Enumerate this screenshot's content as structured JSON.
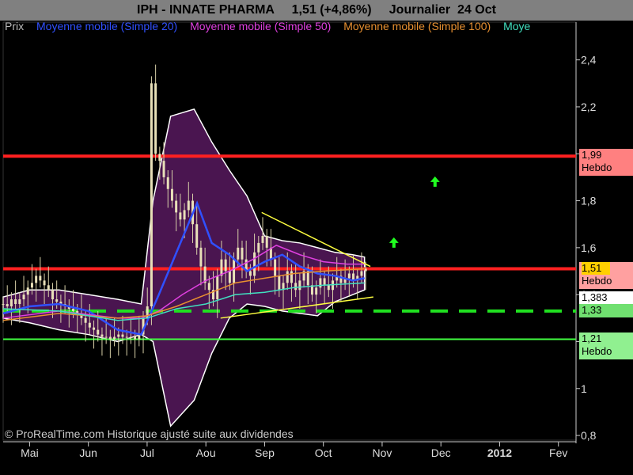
{
  "header": {
    "title": "IPH - INNATE PHARMA     1,51 (+4,86%)     Journalier  24 Oct"
  },
  "legend": [
    {
      "label": "Prix",
      "color": "#bbbbbb"
    },
    {
      "label": "Moyenne mobile (Simple 20)",
      "color": "#3050ff"
    },
    {
      "label": "Moyenne mobile (Simple 50)",
      "color": "#e040e0"
    },
    {
      "label": "Moyenne mobile (Simple 100)",
      "color": "#e89030"
    },
    {
      "label": "Moye",
      "color": "#40e0c0"
    }
  ],
  "credit": "© ProRealTime.com Historique ajusté suite aux dividendes",
  "price_boxes": [
    {
      "value": "1,99",
      "sub": "Hebdo",
      "color": "#ff8080",
      "y": 1.99
    },
    {
      "value": "1,51",
      "sub": "Hebdo",
      "color": "#ffa0a0",
      "value_color": "#ffd000",
      "y": 1.51
    },
    {
      "value": "1,383",
      "sub": "",
      "color": "#ffffff",
      "y": 1.383
    },
    {
      "value": "1,33",
      "sub": "",
      "color": "#70e070",
      "y": 1.33
    },
    {
      "value": "1,21",
      "sub": "Hebdo",
      "color": "#90f090",
      "y": 1.21
    }
  ],
  "chart_data": {
    "type": "candlestick",
    "x_ticks": [
      "Mai",
      "Jun",
      "Jul",
      "Aou",
      "Sep",
      "Oct",
      "Nov",
      "Dec",
      "2012",
      "Fev"
    ],
    "x_tick_months": [
      0,
      1,
      2,
      3,
      4,
      5,
      6,
      7,
      8,
      9
    ],
    "x_start_month": -0.45,
    "x_end_month": 9.3,
    "y_ticks": [
      0.8,
      1,
      1.2,
      1.4,
      1.6,
      1.8,
      2.0,
      2.2,
      2.4
    ],
    "y_tick_labels": [
      "0,8",
      "1",
      "1,2",
      "1,4",
      "1,6",
      "1,8",
      "2",
      "2,2",
      "2,4"
    ],
    "ylim": [
      0.78,
      2.5
    ],
    "horizontal_lines": [
      {
        "y": 1.99,
        "color": "#ff2020",
        "style": "solid",
        "width": 4
      },
      {
        "y": 1.51,
        "color": "#ff2020",
        "style": "solid",
        "width": 4
      },
      {
        "y": 1.33,
        "color": "#20e020",
        "style": "dashed",
        "width": 4
      },
      {
        "y": 1.21,
        "color": "#40ff40",
        "style": "solid",
        "width": 2
      }
    ],
    "bollinger": {
      "color_fill": "#4a1550",
      "x": [
        -0.45,
        0.0,
        0.5,
        1.0,
        1.5,
        1.9,
        2.1,
        2.4,
        2.8,
        3.1,
        3.4,
        3.7,
        4.0,
        4.3,
        4.6,
        4.9,
        5.2,
        5.5,
        5.7
      ],
      "upper": [
        1.39,
        1.42,
        1.42,
        1.4,
        1.38,
        1.36,
        1.8,
        2.16,
        2.19,
        2.05,
        1.93,
        1.82,
        1.65,
        1.63,
        1.62,
        1.6,
        1.58,
        1.57,
        1.56
      ],
      "lower": [
        1.3,
        1.28,
        1.25,
        1.23,
        1.2,
        1.23,
        1.2,
        0.84,
        0.95,
        1.15,
        1.3,
        1.36,
        1.35,
        1.33,
        1.32,
        1.31,
        1.37,
        1.4,
        1.42
      ]
    },
    "series": [
      {
        "name": "Moyenne mobile (Simple 20)",
        "color": "#3050ff",
        "x": [
          -0.45,
          0.0,
          0.5,
          1.0,
          1.5,
          1.9,
          2.2,
          2.5,
          2.85,
          3.1,
          3.4,
          3.7,
          4.0,
          4.3,
          4.6,
          4.9,
          5.2,
          5.5,
          5.7
        ],
        "y": [
          1.32,
          1.35,
          1.36,
          1.33,
          1.25,
          1.23,
          1.4,
          1.58,
          1.79,
          1.62,
          1.57,
          1.5,
          1.54,
          1.57,
          1.52,
          1.49,
          1.48,
          1.46,
          1.47
        ]
      },
      {
        "name": "Moyenne mobile (Simple 50)",
        "color": "#e040e0",
        "x": [
          -0.45,
          0.5,
          1.5,
          1.9,
          2.2,
          2.6,
          3.0,
          3.4,
          3.8,
          4.2,
          4.6,
          5.0,
          5.4,
          5.7
        ],
        "y": [
          1.3,
          1.33,
          1.3,
          1.3,
          1.33,
          1.4,
          1.46,
          1.5,
          1.55,
          1.61,
          1.57,
          1.54,
          1.53,
          1.53
        ]
      },
      {
        "name": "Moyenne mobile (Simple 100)",
        "color": "#e89030",
        "x": [
          -0.45,
          0.5,
          1.5,
          2.0,
          2.5,
          3.0,
          3.5,
          4.0,
          4.5,
          5.0,
          5.7
        ],
        "y": [
          1.29,
          1.32,
          1.3,
          1.31,
          1.35,
          1.4,
          1.45,
          1.47,
          1.49,
          1.5,
          1.51
        ]
      },
      {
        "name": "Moye",
        "color": "#40e0c0",
        "x": [
          -0.45,
          0.5,
          1.5,
          2.0,
          2.5,
          3.0,
          3.5,
          4.0,
          4.5,
          5.0,
          5.7
        ],
        "y": [
          1.34,
          1.33,
          1.29,
          1.3,
          1.34,
          1.36,
          1.4,
          1.41,
          1.43,
          1.44,
          1.45
        ]
      }
    ],
    "trendlines": [
      {
        "color": "#ffff40",
        "x": [
          3.95,
          5.8
        ],
        "y": [
          1.75,
          1.52
        ]
      },
      {
        "color": "#ffff40",
        "x": [
          3.25,
          5.85
        ],
        "y": [
          1.3,
          1.39
        ]
      }
    ],
    "arrows": [
      {
        "x": 6.9,
        "y": 1.88,
        "color": "#20ff20"
      },
      {
        "x": 6.2,
        "y": 1.62,
        "color": "#20ff20"
      }
    ],
    "candles": {
      "x_start": -0.45,
      "x_end": 5.72,
      "closes": [
        1.36,
        1.35,
        1.38,
        1.36,
        1.38,
        1.4,
        1.43,
        1.45,
        1.48,
        1.46,
        1.44,
        1.42,
        1.38,
        1.37,
        1.36,
        1.35,
        1.34,
        1.33,
        1.32,
        1.3,
        1.28,
        1.26,
        1.25,
        1.23,
        1.22,
        1.22,
        1.21,
        1.22,
        1.23,
        1.22,
        1.22,
        1.22,
        1.21,
        1.23,
        1.3,
        1.35,
        2.3,
        2.0,
        1.97,
        1.9,
        1.85,
        1.8,
        1.75,
        1.72,
        1.76,
        1.8,
        1.7,
        1.6,
        1.52,
        1.45,
        1.42,
        1.38,
        1.48,
        1.55,
        1.5,
        1.45,
        1.55,
        1.6,
        1.55,
        1.5,
        1.48,
        1.58,
        1.62,
        1.65,
        1.6,
        1.55,
        1.48,
        1.42,
        1.45,
        1.5,
        1.45,
        1.42,
        1.46,
        1.5,
        1.44,
        1.4,
        1.43,
        1.47,
        1.44,
        1.42,
        1.46,
        1.48,
        1.45,
        1.47,
        1.49,
        1.46,
        1.48,
        1.5,
        1.51
      ],
      "wick": [
        0.03,
        0.08
      ]
    }
  }
}
